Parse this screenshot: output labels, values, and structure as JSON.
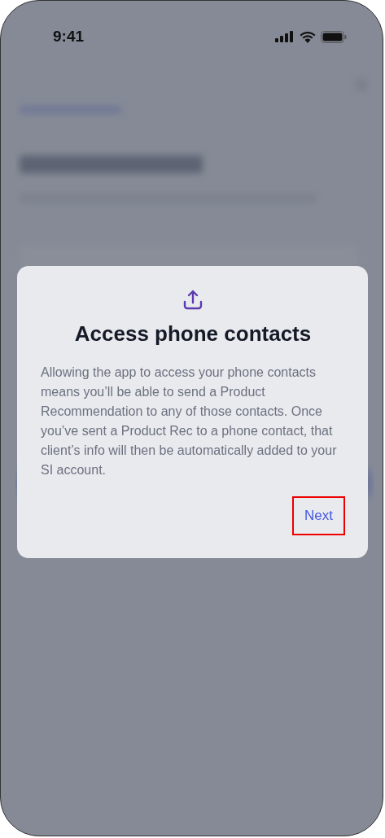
{
  "status_bar": {
    "time": "9:41"
  },
  "dialog": {
    "title": "Access phone contacts",
    "body": "Allowing the app to access your phone contacts means you’ll be able to send a Product Recommendation to any of those contacts. Once you’ve sent a Product Rec to a phone contact, that client’s info will then be automatically added to your SI account.",
    "button": {
      "label": "Next",
      "highlighted": true
    }
  }
}
